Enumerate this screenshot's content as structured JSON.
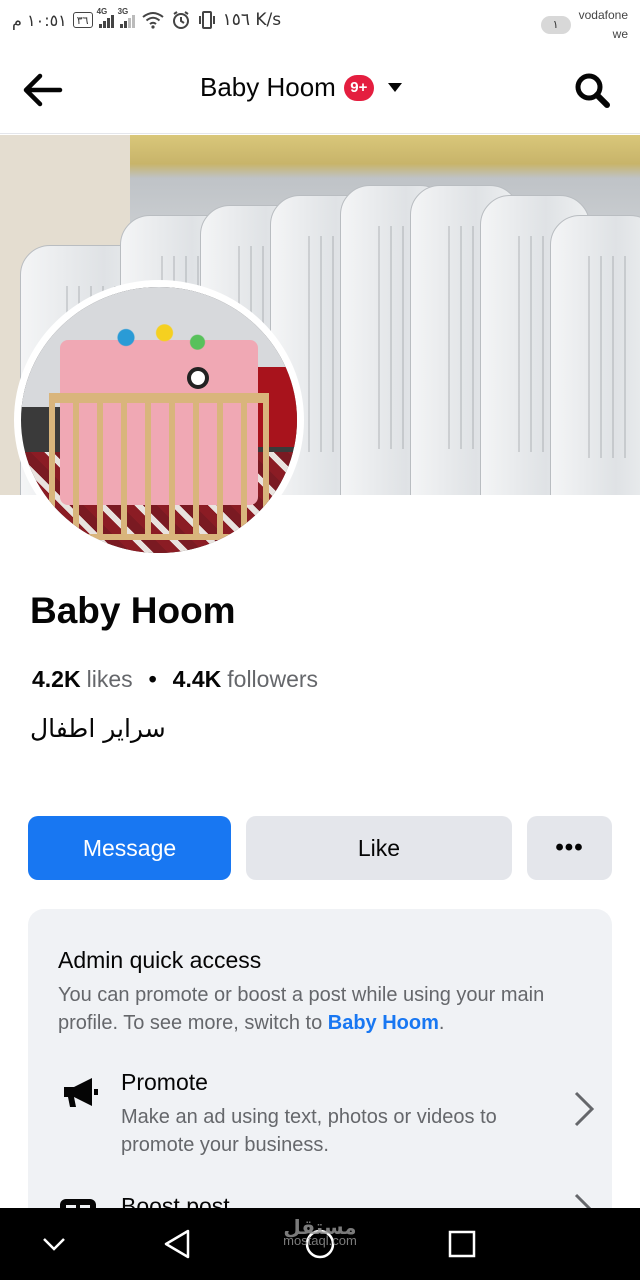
{
  "status_bar": {
    "time": "١٠:٥١ م",
    "battery": "٣٦",
    "net_4g": "4G",
    "net_3g": "3G",
    "speed": "١٥٦ K/s",
    "notif_count": "١",
    "carrier1": "vodafone",
    "carrier2": "we"
  },
  "header": {
    "title": "Baby Hoom",
    "badge": "9+"
  },
  "profile": {
    "name": "Baby Hoom",
    "likes_count": "4.2K",
    "likes_label": "likes",
    "dot": "•",
    "followers_count": "4.4K",
    "followers_label": "followers",
    "category": "سراير اطفال"
  },
  "actions": {
    "message": "Message",
    "like": "Like",
    "more": "•••"
  },
  "admin": {
    "title": "Admin quick access",
    "desc_part1": "You can promote or boost a post while using your main profile. To see more, switch to ",
    "desc_link": "Baby Hoom",
    "desc_end": ".",
    "items": [
      {
        "icon": "megaphone-icon",
        "title": "Promote",
        "desc": "Make an ad using text, photos or videos to promote your business."
      },
      {
        "icon": "boost-post-icon",
        "title": "Boost post",
        "desc": ""
      }
    ]
  },
  "watermark": {
    "arabic": "مستقل",
    "latin": "mostaql.com"
  },
  "colors": {
    "primary": "#1877f2",
    "badge": "#e41e3f",
    "button_gray": "#e4e6eb",
    "card_bg": "#f0f2f5",
    "secondary_text": "#65676b"
  }
}
